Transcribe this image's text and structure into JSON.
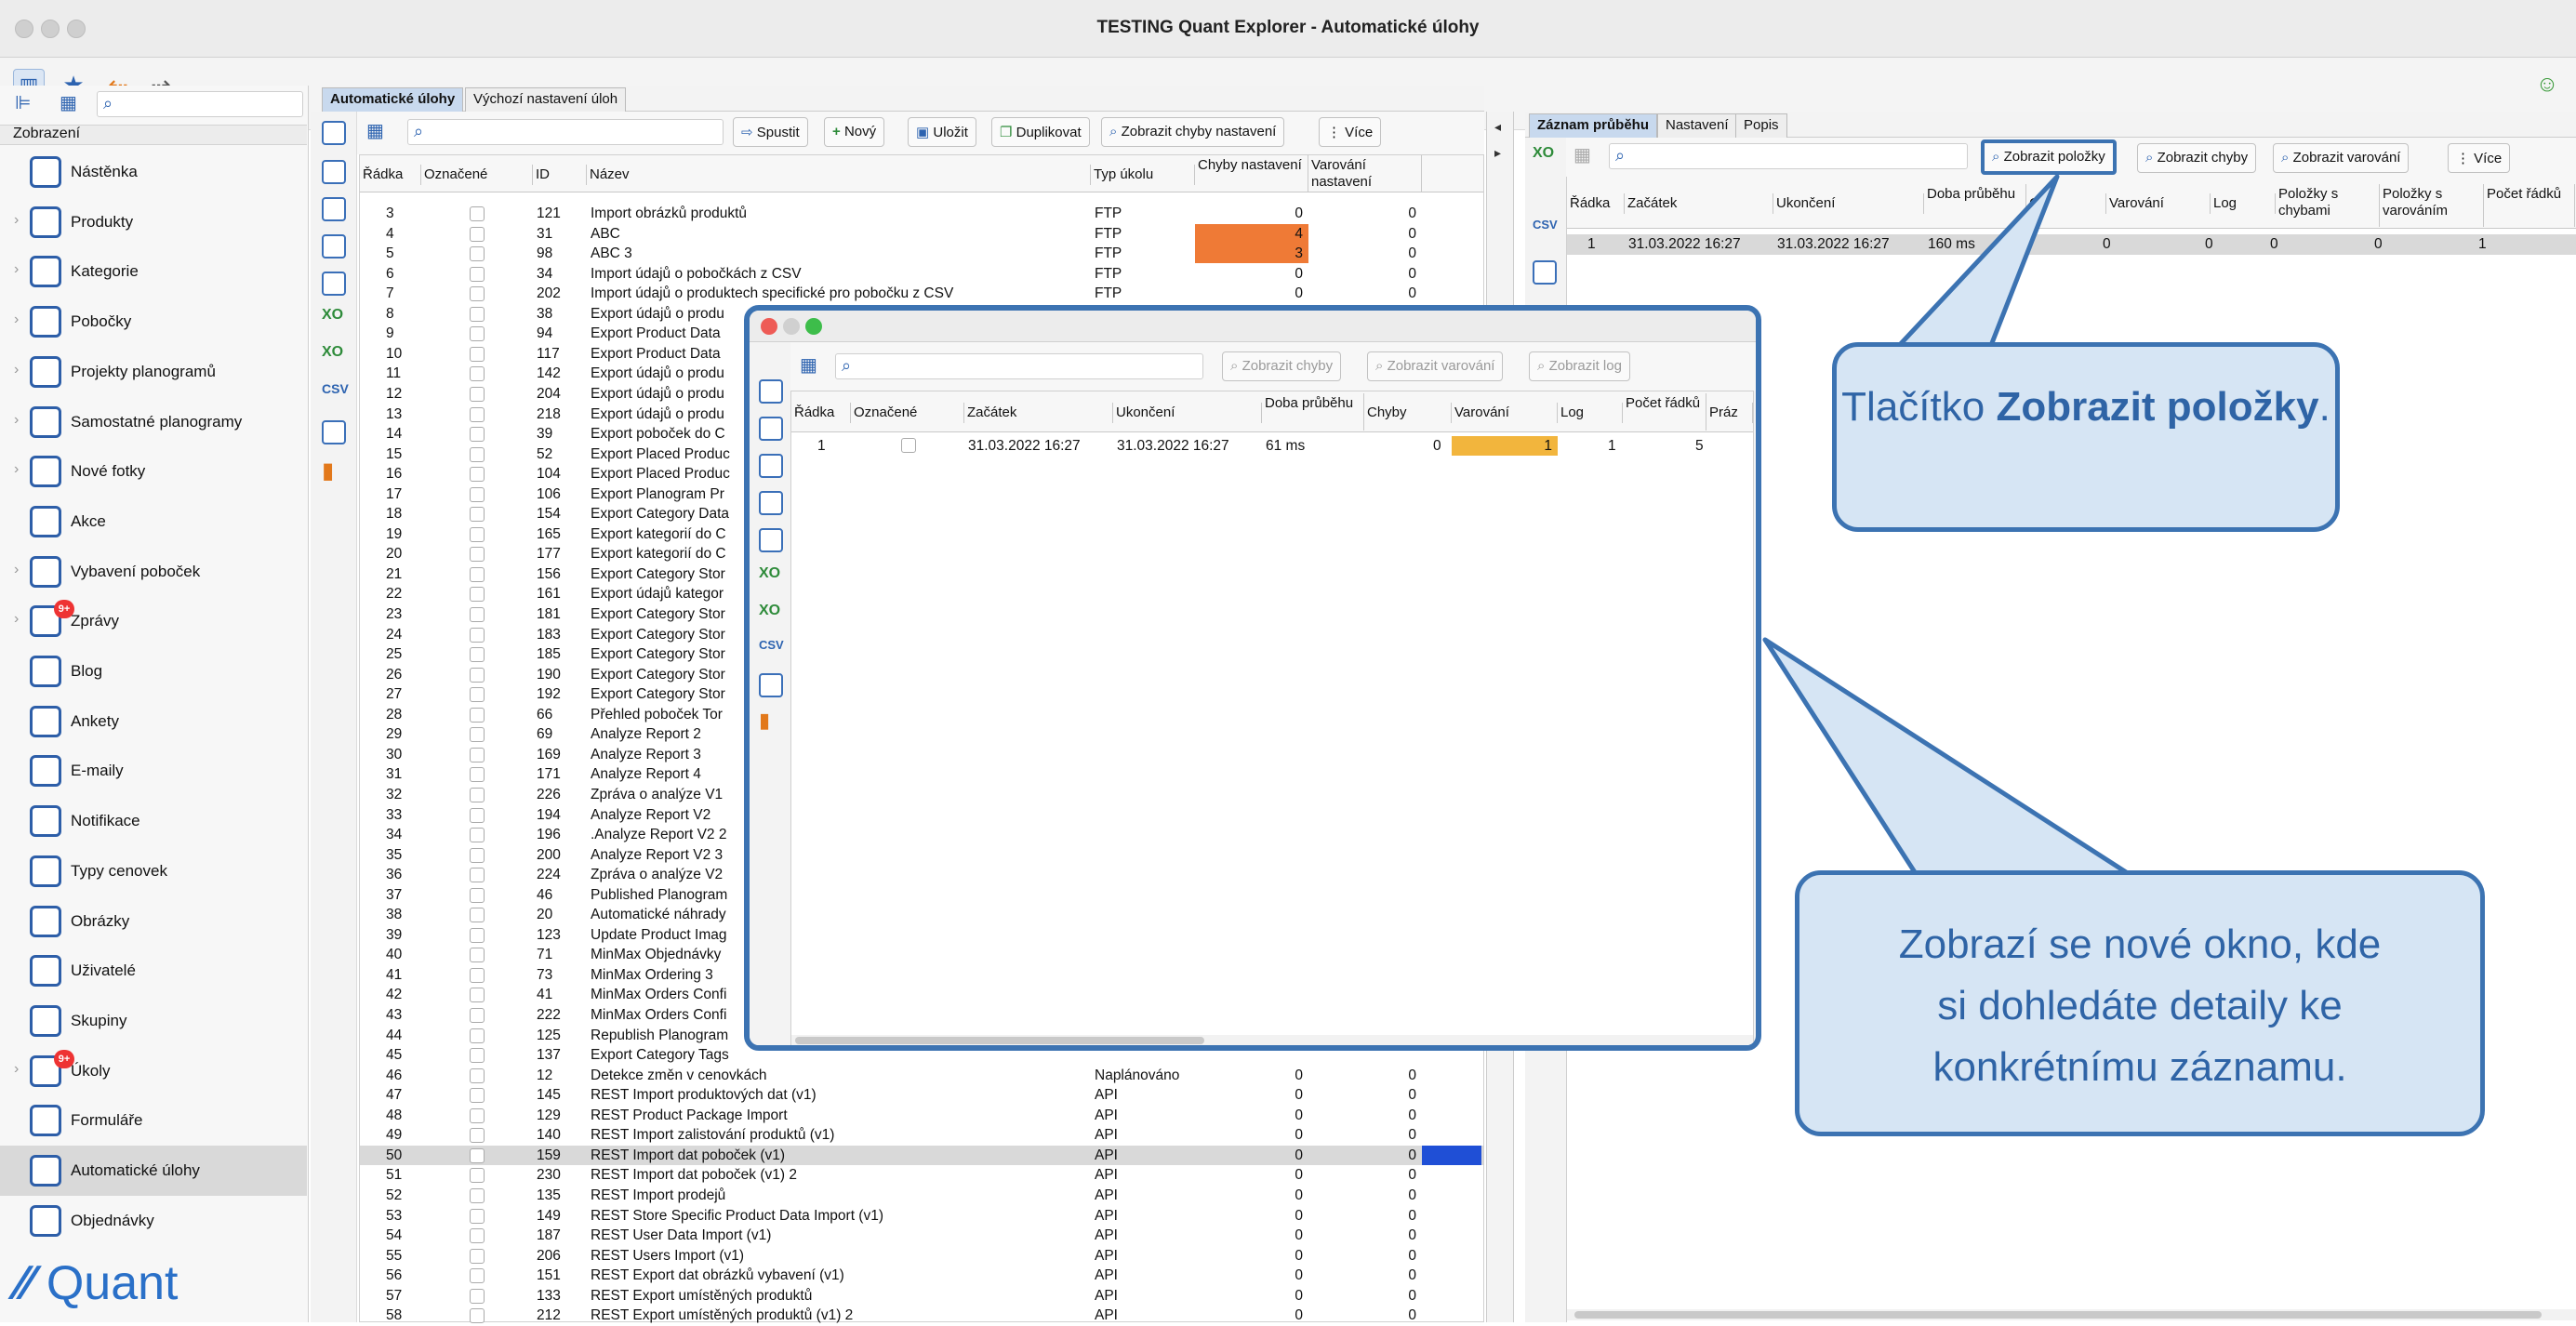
{
  "window": {
    "title": "TESTING Quant Explorer - Automatické úlohy"
  },
  "sidebar": {
    "header": "Zobrazení",
    "items": [
      {
        "label": "Nástěnka",
        "chev": false,
        "badge": ""
      },
      {
        "label": "Produkty",
        "chev": true,
        "badge": ""
      },
      {
        "label": "Kategorie",
        "chev": true,
        "badge": ""
      },
      {
        "label": "Pobočky",
        "chev": true,
        "badge": ""
      },
      {
        "label": "Projekty planogramů",
        "chev": true,
        "badge": ""
      },
      {
        "label": "Samostatné planogramy",
        "chev": true,
        "badge": ""
      },
      {
        "label": "Nové fotky",
        "chev": true,
        "badge": ""
      },
      {
        "label": "Akce",
        "chev": false,
        "badge": ""
      },
      {
        "label": "Vybavení poboček",
        "chev": true,
        "badge": ""
      },
      {
        "label": "Zprávy",
        "chev": true,
        "badge": "9+"
      },
      {
        "label": "Blog",
        "chev": false,
        "badge": ""
      },
      {
        "label": "Ankety",
        "chev": false,
        "badge": ""
      },
      {
        "label": "E-maily",
        "chev": false,
        "badge": ""
      },
      {
        "label": "Notifikace",
        "chev": false,
        "badge": ""
      },
      {
        "label": "Typy cenovek",
        "chev": false,
        "badge": ""
      },
      {
        "label": "Obrázky",
        "chev": false,
        "badge": ""
      },
      {
        "label": "Uživatelé",
        "chev": false,
        "badge": ""
      },
      {
        "label": "Skupiny",
        "chev": false,
        "badge": ""
      },
      {
        "label": "Úkoly",
        "chev": true,
        "badge": "9+"
      },
      {
        "label": "Formuláře",
        "chev": false,
        "badge": ""
      },
      {
        "label": "Automatické úlohy",
        "chev": false,
        "badge": "",
        "selected": true
      },
      {
        "label": "Objednávky",
        "chev": false,
        "badge": ""
      }
    ],
    "logo": "Quant"
  },
  "main": {
    "tabs": [
      "Automatické úlohy",
      "Výchozí nastavení úloh"
    ],
    "buttons": [
      "Spustit",
      "Nový",
      "Uložit",
      "Duplikovat",
      "Zobrazit chyby nastavení",
      "Více"
    ],
    "columns": [
      "Řádka",
      "Označené",
      "ID",
      "Název",
      "Typ úkolu",
      "Chyby nastavení",
      "Varování nastavení"
    ],
    "rows": [
      [
        "3",
        "121",
        "Import obrázků produktů",
        "FTP",
        "0",
        "0",
        ""
      ],
      [
        "4",
        "31",
        "ABC",
        "FTP",
        "4",
        "0",
        "orange"
      ],
      [
        "5",
        "98",
        "ABC 3",
        "FTP",
        "3",
        "0",
        "orange"
      ],
      [
        "6",
        "34",
        "Import údajů o pobočkách z CSV",
        "FTP",
        "0",
        "0",
        ""
      ],
      [
        "7",
        "202",
        "Import údajů o produktech specifické pro pobočku z CSV",
        "FTP",
        "0",
        "0",
        ""
      ],
      [
        "8",
        "38",
        "Export údajů o produ",
        "",
        "",
        "",
        ""
      ],
      [
        "9",
        "94",
        "Export Product Data",
        "",
        "",
        "",
        ""
      ],
      [
        "10",
        "117",
        "Export Product Data",
        "",
        "",
        "",
        ""
      ],
      [
        "11",
        "142",
        "Export údajů o produ",
        "",
        "",
        "",
        ""
      ],
      [
        "12",
        "204",
        "Export údajů o produ",
        "",
        "",
        "",
        ""
      ],
      [
        "13",
        "218",
        "Export údajů o produ",
        "",
        "",
        "",
        ""
      ],
      [
        "14",
        "39",
        "Export poboček do C",
        "",
        "",
        "",
        ""
      ],
      [
        "15",
        "52",
        "Export Placed Produc",
        "",
        "",
        "",
        ""
      ],
      [
        "16",
        "104",
        "Export Placed Produc",
        "",
        "",
        "",
        ""
      ],
      [
        "17",
        "106",
        "Export Planogram Pr",
        "",
        "",
        "",
        ""
      ],
      [
        "18",
        "154",
        "Export Category Data",
        "",
        "",
        "",
        ""
      ],
      [
        "19",
        "165",
        "Export kategorií do C",
        "",
        "",
        "",
        ""
      ],
      [
        "20",
        "177",
        "Export kategorií do C",
        "",
        "",
        "",
        ""
      ],
      [
        "21",
        "156",
        "Export Category Stor",
        "",
        "",
        "",
        ""
      ],
      [
        "22",
        "161",
        "Export údajů kategor",
        "",
        "",
        "",
        ""
      ],
      [
        "23",
        "181",
        "Export Category Stor",
        "",
        "",
        "",
        ""
      ],
      [
        "24",
        "183",
        "Export Category Stor",
        "",
        "",
        "",
        ""
      ],
      [
        "25",
        "185",
        "Export Category Stor",
        "",
        "",
        "",
        ""
      ],
      [
        "26",
        "190",
        "Export Category Stor",
        "",
        "",
        "",
        ""
      ],
      [
        "27",
        "192",
        "Export Category Stor",
        "",
        "",
        "",
        ""
      ],
      [
        "28",
        "66",
        "Přehled poboček Tor",
        "",
        "",
        "",
        ""
      ],
      [
        "29",
        "69",
        "Analyze Report 2",
        "",
        "",
        "",
        ""
      ],
      [
        "30",
        "169",
        "Analyze Report 3",
        "",
        "",
        "",
        ""
      ],
      [
        "31",
        "171",
        "Analyze Report 4",
        "",
        "",
        "",
        ""
      ],
      [
        "32",
        "226",
        "Zpráva o analýze V1",
        "",
        "",
        "",
        ""
      ],
      [
        "33",
        "194",
        "Analyze Report V2",
        "",
        "",
        "",
        ""
      ],
      [
        "34",
        "196",
        ".Analyze Report V2 2",
        "",
        "",
        "",
        ""
      ],
      [
        "35",
        "200",
        "Analyze Report V2 3",
        "",
        "",
        "",
        ""
      ],
      [
        "36",
        "224",
        "Zpráva o analýze V2",
        "",
        "",
        "",
        ""
      ],
      [
        "37",
        "46",
        "Published Planogram",
        "",
        "",
        "",
        ""
      ],
      [
        "38",
        "20",
        "Automatické náhrady",
        "",
        "",
        "",
        ""
      ],
      [
        "39",
        "123",
        "Update Product Imag",
        "",
        "",
        "",
        ""
      ],
      [
        "40",
        "71",
        "MinMax Objednávky",
        "",
        "",
        "",
        ""
      ],
      [
        "41",
        "73",
        "MinMax Ordering 3",
        "",
        "",
        "",
        ""
      ],
      [
        "42",
        "41",
        "MinMax Orders Confi",
        "",
        "",
        "",
        ""
      ],
      [
        "43",
        "222",
        "MinMax Orders Confi",
        "",
        "",
        "",
        ""
      ],
      [
        "44",
        "125",
        "Republish Planogram",
        "",
        "",
        "",
        ""
      ],
      [
        "45",
        "137",
        "Export Category Tags",
        "",
        "",
        "",
        ""
      ],
      [
        "46",
        "12",
        "Detekce změn v cenovkách",
        "Naplánováno",
        "0",
        "0",
        ""
      ],
      [
        "47",
        "145",
        "REST Import produktových dat (v1)",
        "API",
        "0",
        "0",
        ""
      ],
      [
        "48",
        "129",
        "REST Product Package Import",
        "API",
        "0",
        "0",
        ""
      ],
      [
        "49",
        "140",
        "REST Import zalistování produktů (v1)",
        "API",
        "0",
        "0",
        ""
      ],
      [
        "50",
        "159",
        "REST Import dat poboček (v1)",
        "API",
        "0",
        "0",
        "blue"
      ],
      [
        "51",
        "230",
        "REST Import dat poboček (v1) 2",
        "API",
        "0",
        "0",
        ""
      ],
      [
        "52",
        "135",
        "REST Import prodejů",
        "API",
        "0",
        "0",
        ""
      ],
      [
        "53",
        "149",
        "REST Store Specific Product Data Import (v1)",
        "API",
        "0",
        "0",
        ""
      ],
      [
        "54",
        "187",
        "REST User Data Import (v1)",
        "API",
        "0",
        "0",
        ""
      ],
      [
        "55",
        "206",
        "REST Users Import (v1)",
        "API",
        "0",
        "0",
        ""
      ],
      [
        "56",
        "151",
        "REST Export dat obrázků vybavení (v1)",
        "API",
        "0",
        "0",
        ""
      ],
      [
        "57",
        "133",
        "REST Export umístěných produktů",
        "API",
        "0",
        "0",
        ""
      ],
      [
        "58",
        "212",
        "REST Export umístěných produktů (v1) 2",
        "API",
        "0",
        "0",
        ""
      ]
    ]
  },
  "right": {
    "tabs": [
      "Záznam průběhu",
      "Nastavení",
      "Popis"
    ],
    "buttons": [
      "Zobrazit položky",
      "Zobrazit chyby",
      "Zobrazit varování",
      "Více"
    ],
    "columns": [
      "Řádka",
      "Začátek",
      "Ukončení",
      "Doba průběhu",
      "Ch",
      "Varování",
      "Log",
      "Položky s chybami",
      "Položky s varováním",
      "Počet řádků"
    ],
    "row": [
      "1",
      "31.03.2022 16:27",
      "31.03.2022 16:27",
      "160 ms",
      "0",
      "0",
      "0",
      "0",
      "1"
    ]
  },
  "popup": {
    "buttons": [
      "Zobrazit chyby",
      "Zobrazit varování",
      "Zobrazit log"
    ],
    "columns": [
      "Řádka",
      "Označené",
      "Začátek",
      "Ukončení",
      "Doba průběhu",
      "Chyby",
      "Varování",
      "Log",
      "Počet řádků",
      "Práz"
    ],
    "row": [
      "1",
      "31.03.2022 16:27",
      "31.03.2022 16:27",
      "61 ms",
      "0",
      "1",
      "1",
      "5"
    ]
  },
  "callouts": {
    "top_pre": "Tlačítko ",
    "top_bold": "Zobrazit položky",
    "top_post": ".",
    "bottom_l1": "Zobrazí se nové okno, kde",
    "bottom_l2": "si dohledáte detaily ke",
    "bottom_l3": "konkrétnímu záznamu."
  },
  "colors": {
    "accent": "#2d63b0",
    "highlight_orange": "#ef7a36",
    "highlight_blue": "#1f4fd6",
    "popup_yellow": "#f2b53d",
    "callout_bg": "#d6e5f4"
  }
}
